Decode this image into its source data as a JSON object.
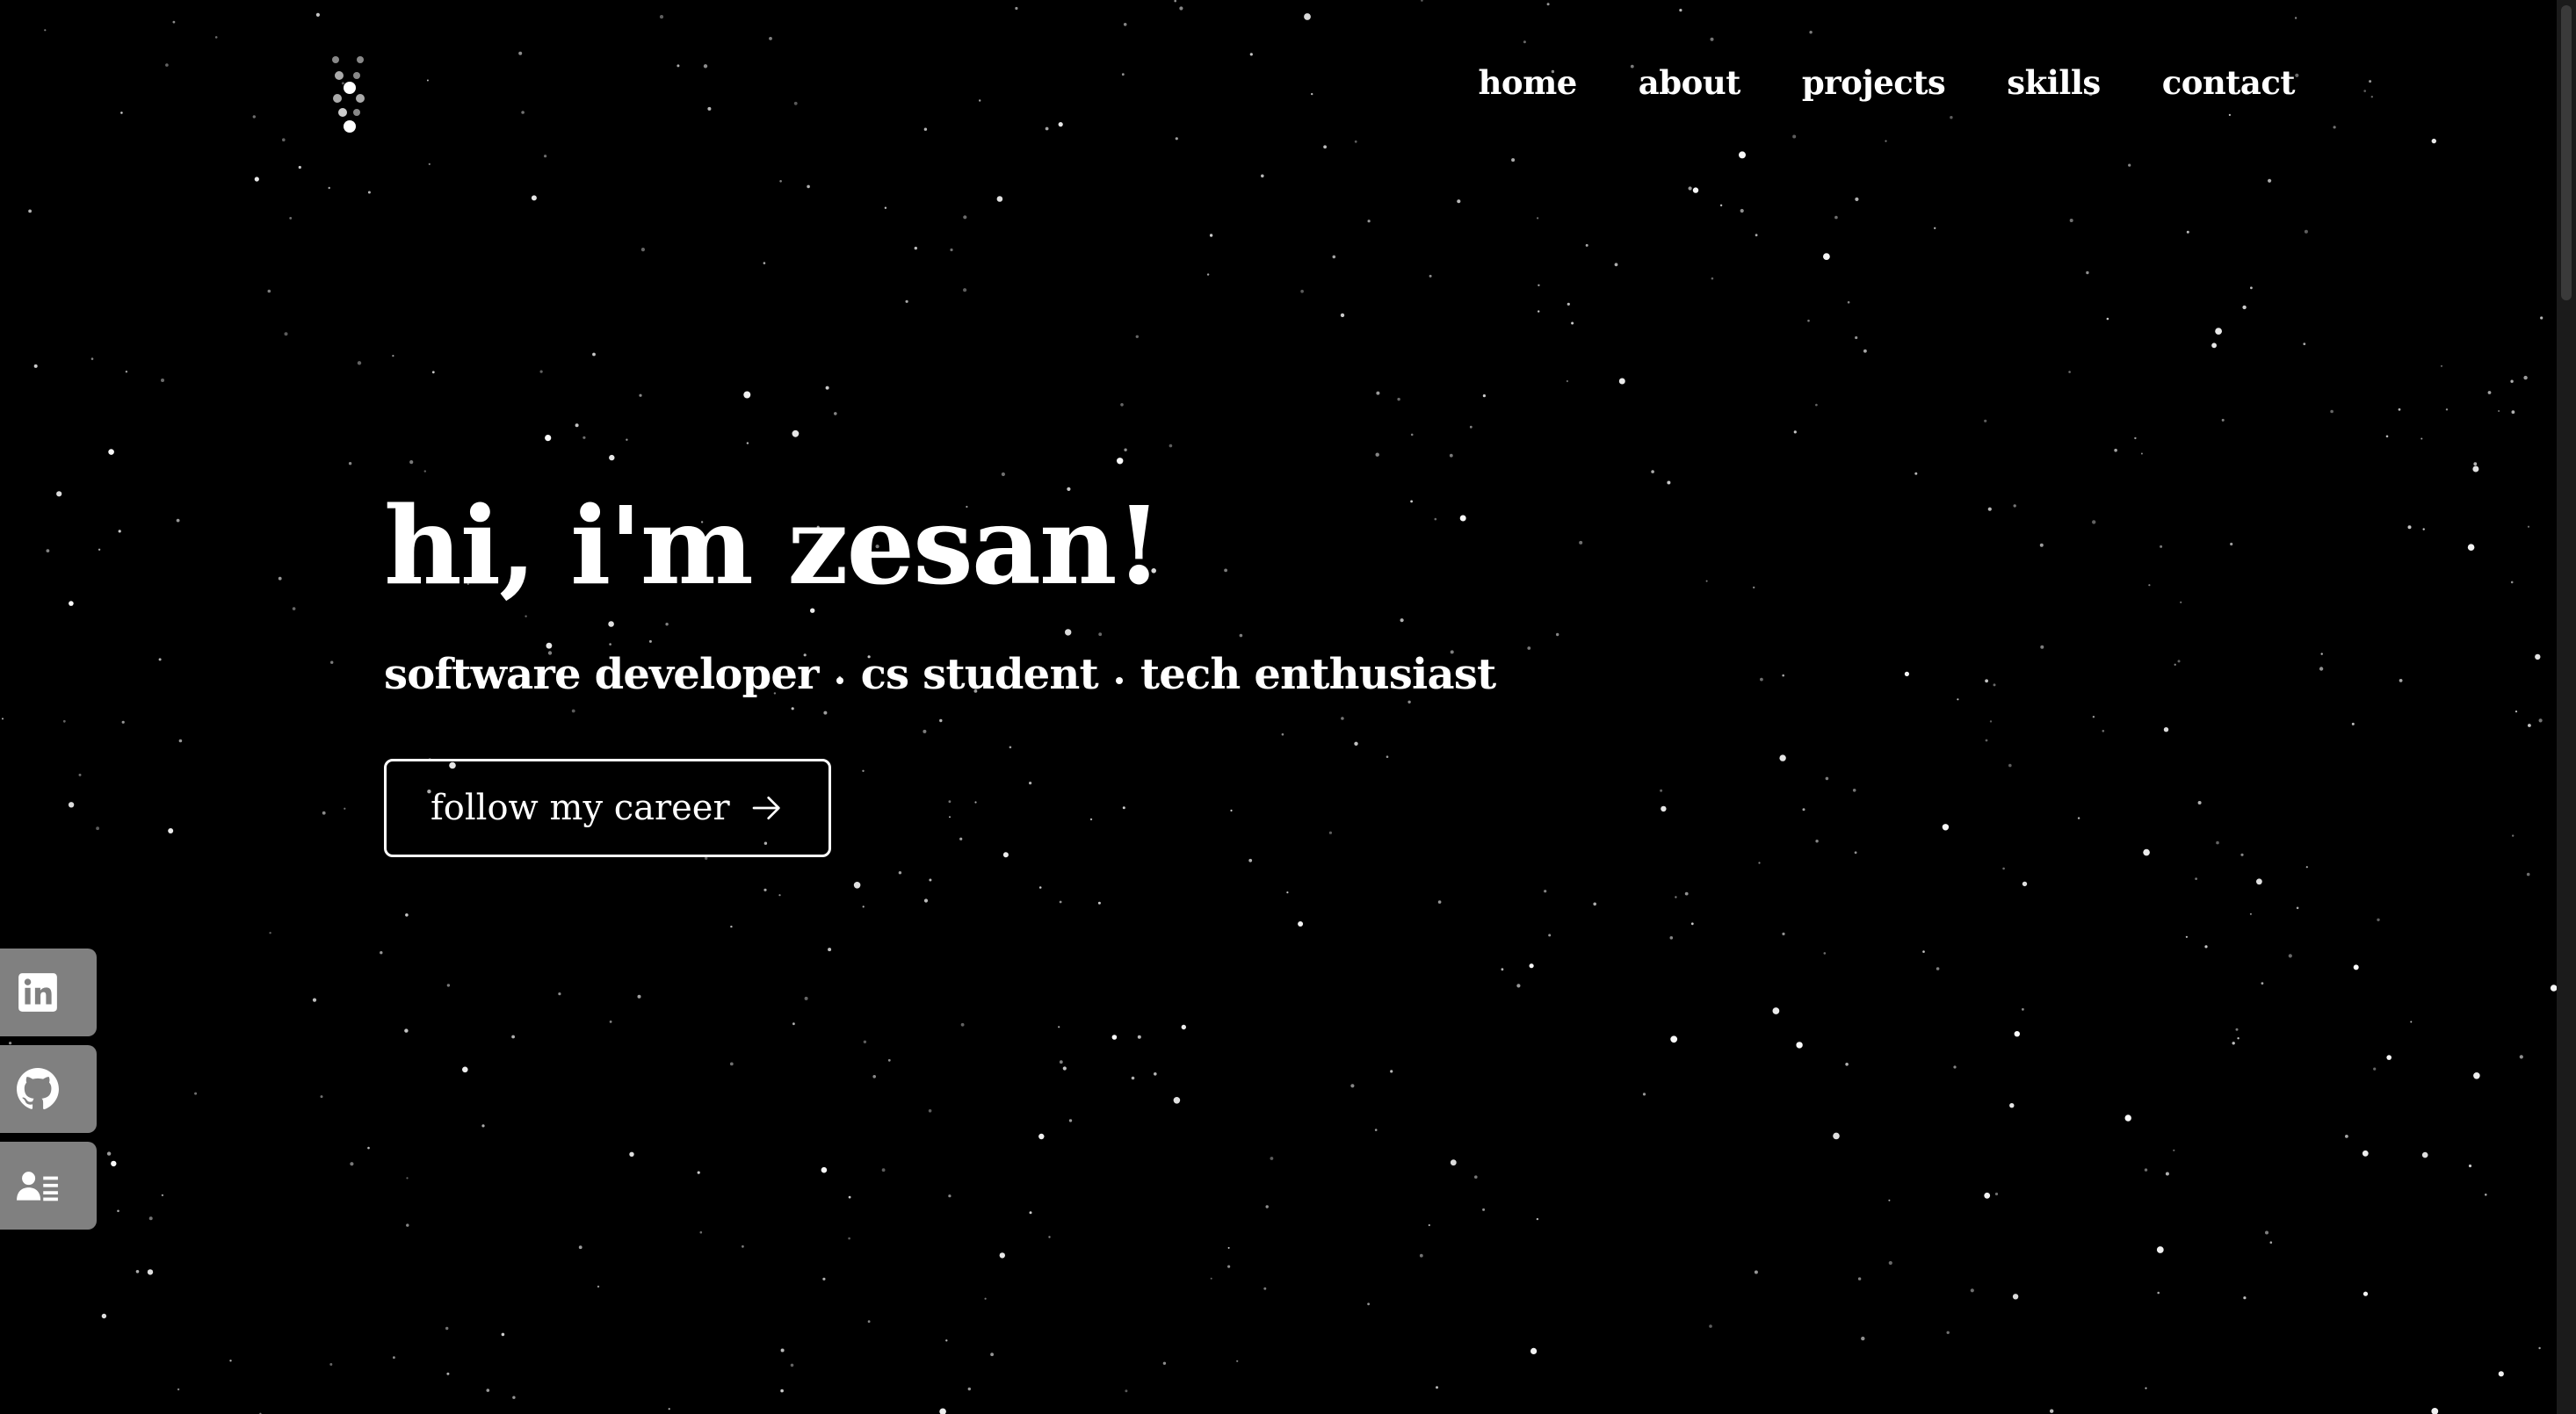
{
  "nav": {
    "items": [
      "home",
      "about",
      "projects",
      "skills",
      "contact"
    ]
  },
  "hero": {
    "title": "hi, i'm zesan!",
    "roles": [
      "software developer",
      "cs student",
      "tech enthusiast"
    ],
    "cta_label": "follow my career"
  },
  "social": {
    "items": [
      {
        "icon": "linkedin-icon"
      },
      {
        "icon": "github-icon"
      },
      {
        "icon": "resume-icon"
      }
    ]
  },
  "colors": {
    "background": "#000000",
    "text": "#ffffff",
    "social_button": "#808080"
  }
}
